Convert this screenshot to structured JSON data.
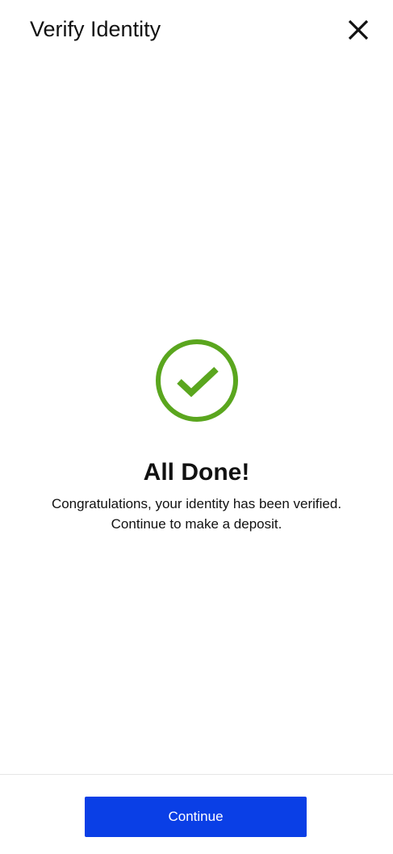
{
  "header": {
    "title": "Verify Identity",
    "close_icon": "close-icon"
  },
  "status": {
    "icon": "check-circle-icon",
    "icon_color": "#5aa61e",
    "title": "All Done!",
    "message_line1": "Congratulations, your identity has been verified.",
    "message_line2": "Continue to make a deposit."
  },
  "footer": {
    "continue_label": "Continue",
    "button_color": "#0a3fe6"
  }
}
